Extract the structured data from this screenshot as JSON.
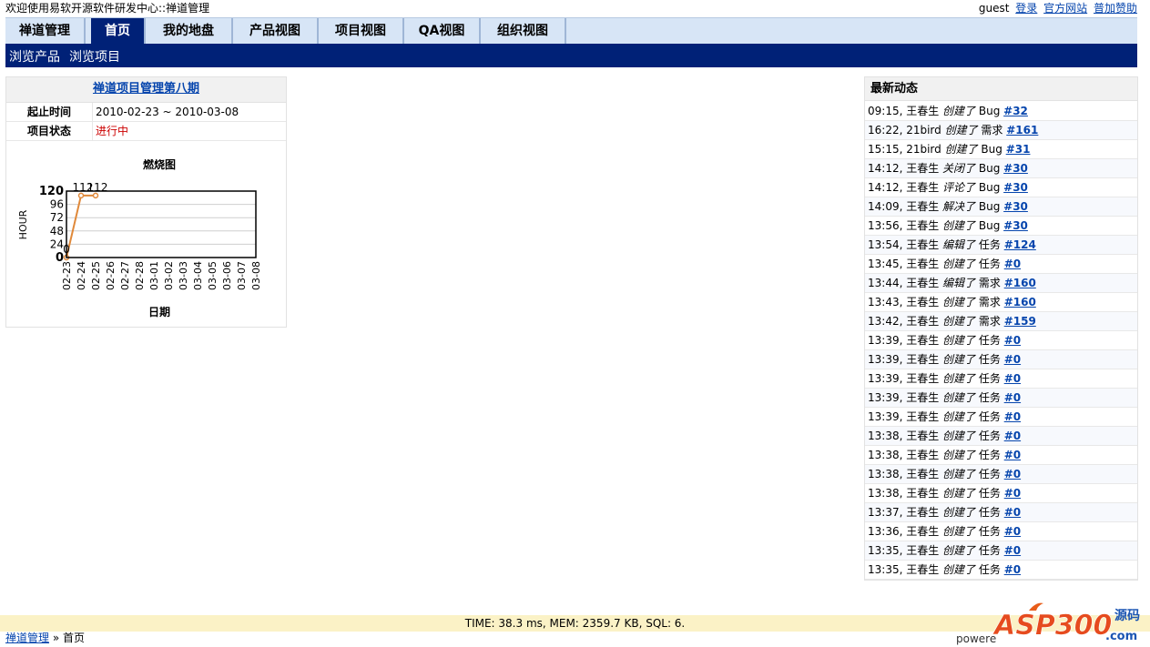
{
  "top": {
    "welcome": "欢迎使用易软开源软件研发中心::禅道管理",
    "user": "guest",
    "links": [
      "登录",
      "官方网站",
      "普加赞助"
    ]
  },
  "nav": {
    "tabs": [
      "禅道管理",
      "首页",
      "我的地盘",
      "产品视图",
      "项目视图",
      "QA视图",
      "组织视图"
    ],
    "active": "首页"
  },
  "subnav": {
    "items": [
      "浏览产品",
      "浏览项目"
    ]
  },
  "project": {
    "name": "禅道项目管理第八期",
    "rows": [
      {
        "label": "起止时间",
        "value": "2010-02-23 ~ 2010-03-08"
      },
      {
        "label": "项目状态",
        "value": "进行中"
      }
    ]
  },
  "chart_data": {
    "type": "line",
    "title": "燃烧图",
    "xlabel": "日期",
    "ylabel": "HOUR",
    "categories": [
      "02-23",
      "02-24",
      "02-25",
      "02-26",
      "02-27",
      "02-28",
      "03-01",
      "03-02",
      "03-03",
      "03-04",
      "03-05",
      "03-06",
      "03-07",
      "03-08"
    ],
    "yticks": [
      0,
      24,
      48,
      72,
      96,
      120
    ],
    "ylim": [
      0,
      120
    ],
    "series": [
      {
        "values": [
          0,
          112,
          112
        ],
        "labels": [
          "0",
          "112",
          "112"
        ],
        "color": "#e0893a"
      }
    ]
  },
  "dynamics": {
    "title": "最新动态",
    "items": [
      {
        "time": "09:15",
        "user": "王春生",
        "action": "创建了",
        "type": "Bug",
        "link": "#32"
      },
      {
        "time": "16:22",
        "user": "21bird",
        "action": "创建了",
        "type": "需求",
        "link": "#161"
      },
      {
        "time": "15:15",
        "user": "21bird",
        "action": "创建了",
        "type": "Bug",
        "link": "#31"
      },
      {
        "time": "14:12",
        "user": "王春生",
        "action": "关闭了",
        "type": "Bug",
        "link": "#30"
      },
      {
        "time": "14:12",
        "user": "王春生",
        "action": "评论了",
        "type": "Bug",
        "link": "#30"
      },
      {
        "time": "14:09",
        "user": "王春生",
        "action": "解决了",
        "type": "Bug",
        "link": "#30"
      },
      {
        "time": "13:56",
        "user": "王春生",
        "action": "创建了",
        "type": "Bug",
        "link": "#30"
      },
      {
        "time": "13:54",
        "user": "王春生",
        "action": "编辑了",
        "type": "任务",
        "link": "#124"
      },
      {
        "time": "13:45",
        "user": "王春生",
        "action": "创建了",
        "type": "任务",
        "link": "#0"
      },
      {
        "time": "13:44",
        "user": "王春生",
        "action": "编辑了",
        "type": "需求",
        "link": "#160"
      },
      {
        "time": "13:43",
        "user": "王春生",
        "action": "创建了",
        "type": "需求",
        "link": "#160"
      },
      {
        "time": "13:42",
        "user": "王春生",
        "action": "创建了",
        "type": "需求",
        "link": "#159"
      },
      {
        "time": "13:39",
        "user": "王春生",
        "action": "创建了",
        "type": "任务",
        "link": "#0"
      },
      {
        "time": "13:39",
        "user": "王春生",
        "action": "创建了",
        "type": "任务",
        "link": "#0"
      },
      {
        "time": "13:39",
        "user": "王春生",
        "action": "创建了",
        "type": "任务",
        "link": "#0"
      },
      {
        "time": "13:39",
        "user": "王春生",
        "action": "创建了",
        "type": "任务",
        "link": "#0"
      },
      {
        "time": "13:39",
        "user": "王春生",
        "action": "创建了",
        "type": "任务",
        "link": "#0"
      },
      {
        "time": "13:38",
        "user": "王春生",
        "action": "创建了",
        "type": "任务",
        "link": "#0"
      },
      {
        "time": "13:38",
        "user": "王春生",
        "action": "创建了",
        "type": "任务",
        "link": "#0"
      },
      {
        "time": "13:38",
        "user": "王春生",
        "action": "创建了",
        "type": "任务",
        "link": "#0"
      },
      {
        "time": "13:38",
        "user": "王春生",
        "action": "创建了",
        "type": "任务",
        "link": "#0"
      },
      {
        "time": "13:37",
        "user": "王春生",
        "action": "创建了",
        "type": "任务",
        "link": "#0"
      },
      {
        "time": "13:36",
        "user": "王春生",
        "action": "创建了",
        "type": "任务",
        "link": "#0"
      },
      {
        "time": "13:35",
        "user": "王春生",
        "action": "创建了",
        "type": "任务",
        "link": "#0"
      },
      {
        "time": "13:35",
        "user": "王春生",
        "action": "创建了",
        "type": "任务",
        "link": "#0"
      }
    ]
  },
  "footer": {
    "stats": "TIME: 38.3 ms, MEM: 2359.7 KB, SQL: 6.",
    "breadcrumb_home": "禅道管理",
    "breadcrumb_sep": "»",
    "breadcrumb_current": "首页",
    "powered": "powere",
    "logo_text": "ASP300",
    "logo_side": "源码",
    "logo_domain": ".com"
  }
}
